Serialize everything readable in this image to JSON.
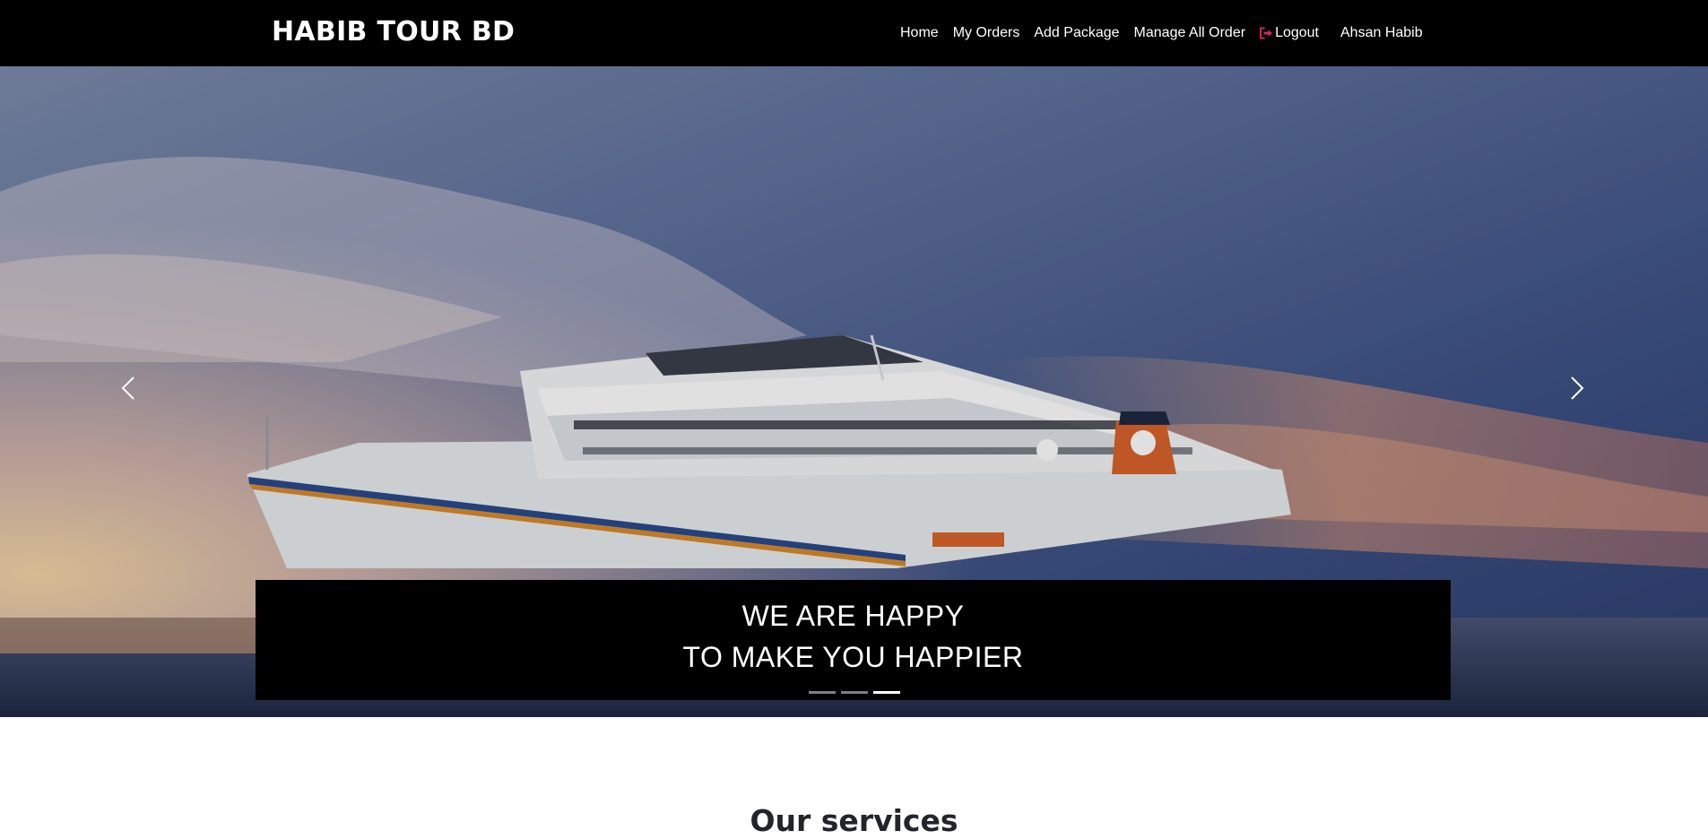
{
  "navbar": {
    "brand": "HABIB TOUR BD",
    "links": [
      "Home",
      "My Orders",
      "Add Package",
      "Manage All Order"
    ],
    "logout_label": "Logout",
    "user_name": "Ahsan Habib",
    "logout_icon": "sign-out-icon",
    "logout_icon_color": "#e0245e"
  },
  "hero": {
    "caption_line1": "WE ARE HAPPY",
    "caption_line2": "TO MAKE YOU HAPPIER",
    "slide_count": 3,
    "active_slide": 3,
    "prev_icon": "chevron-left-icon",
    "next_icon": "chevron-right-icon"
  },
  "services": {
    "title": "Our services"
  }
}
